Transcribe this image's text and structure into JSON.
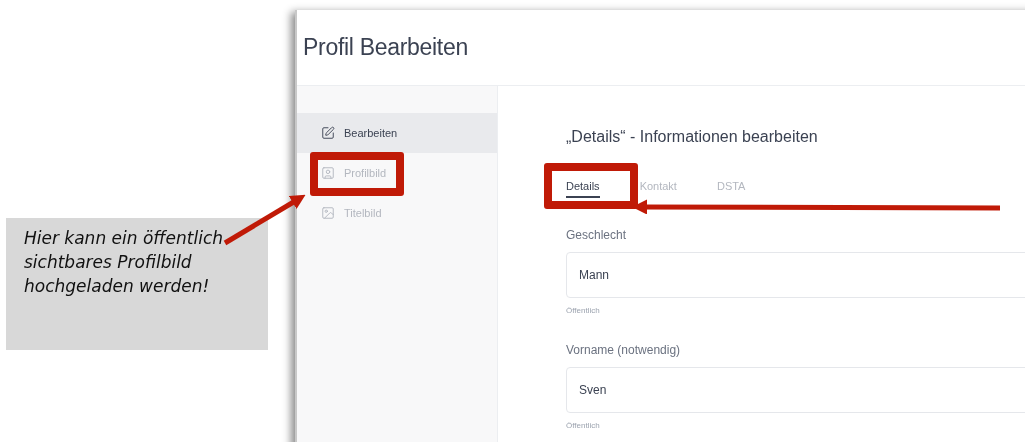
{
  "page_title": "Profil Bearbeiten",
  "sidebar": {
    "items": [
      {
        "kind": "edit",
        "label": "Bearbeiten",
        "selected": true
      },
      {
        "kind": "profile",
        "label": "Profilbild",
        "selected": false
      },
      {
        "kind": "cover",
        "label": "Titelbild",
        "selected": false
      }
    ]
  },
  "heading": "„Details“ - Informationen bearbeiten",
  "tabs": [
    {
      "label": "Details",
      "selected": true
    },
    {
      "label": "Kontakt",
      "selected": false
    },
    {
      "label": "DSTA",
      "selected": false
    }
  ],
  "fields": [
    {
      "label": "Geschlecht",
      "value": "Mann",
      "hint": "Öffentlich"
    },
    {
      "label": "Vorname (notwendig)",
      "value": "Sven",
      "hint": "Öffentlich"
    }
  ],
  "callout": {
    "text": "Hier kann ein öffentlich sichtbares Profilbild hochgeladen werden!"
  }
}
